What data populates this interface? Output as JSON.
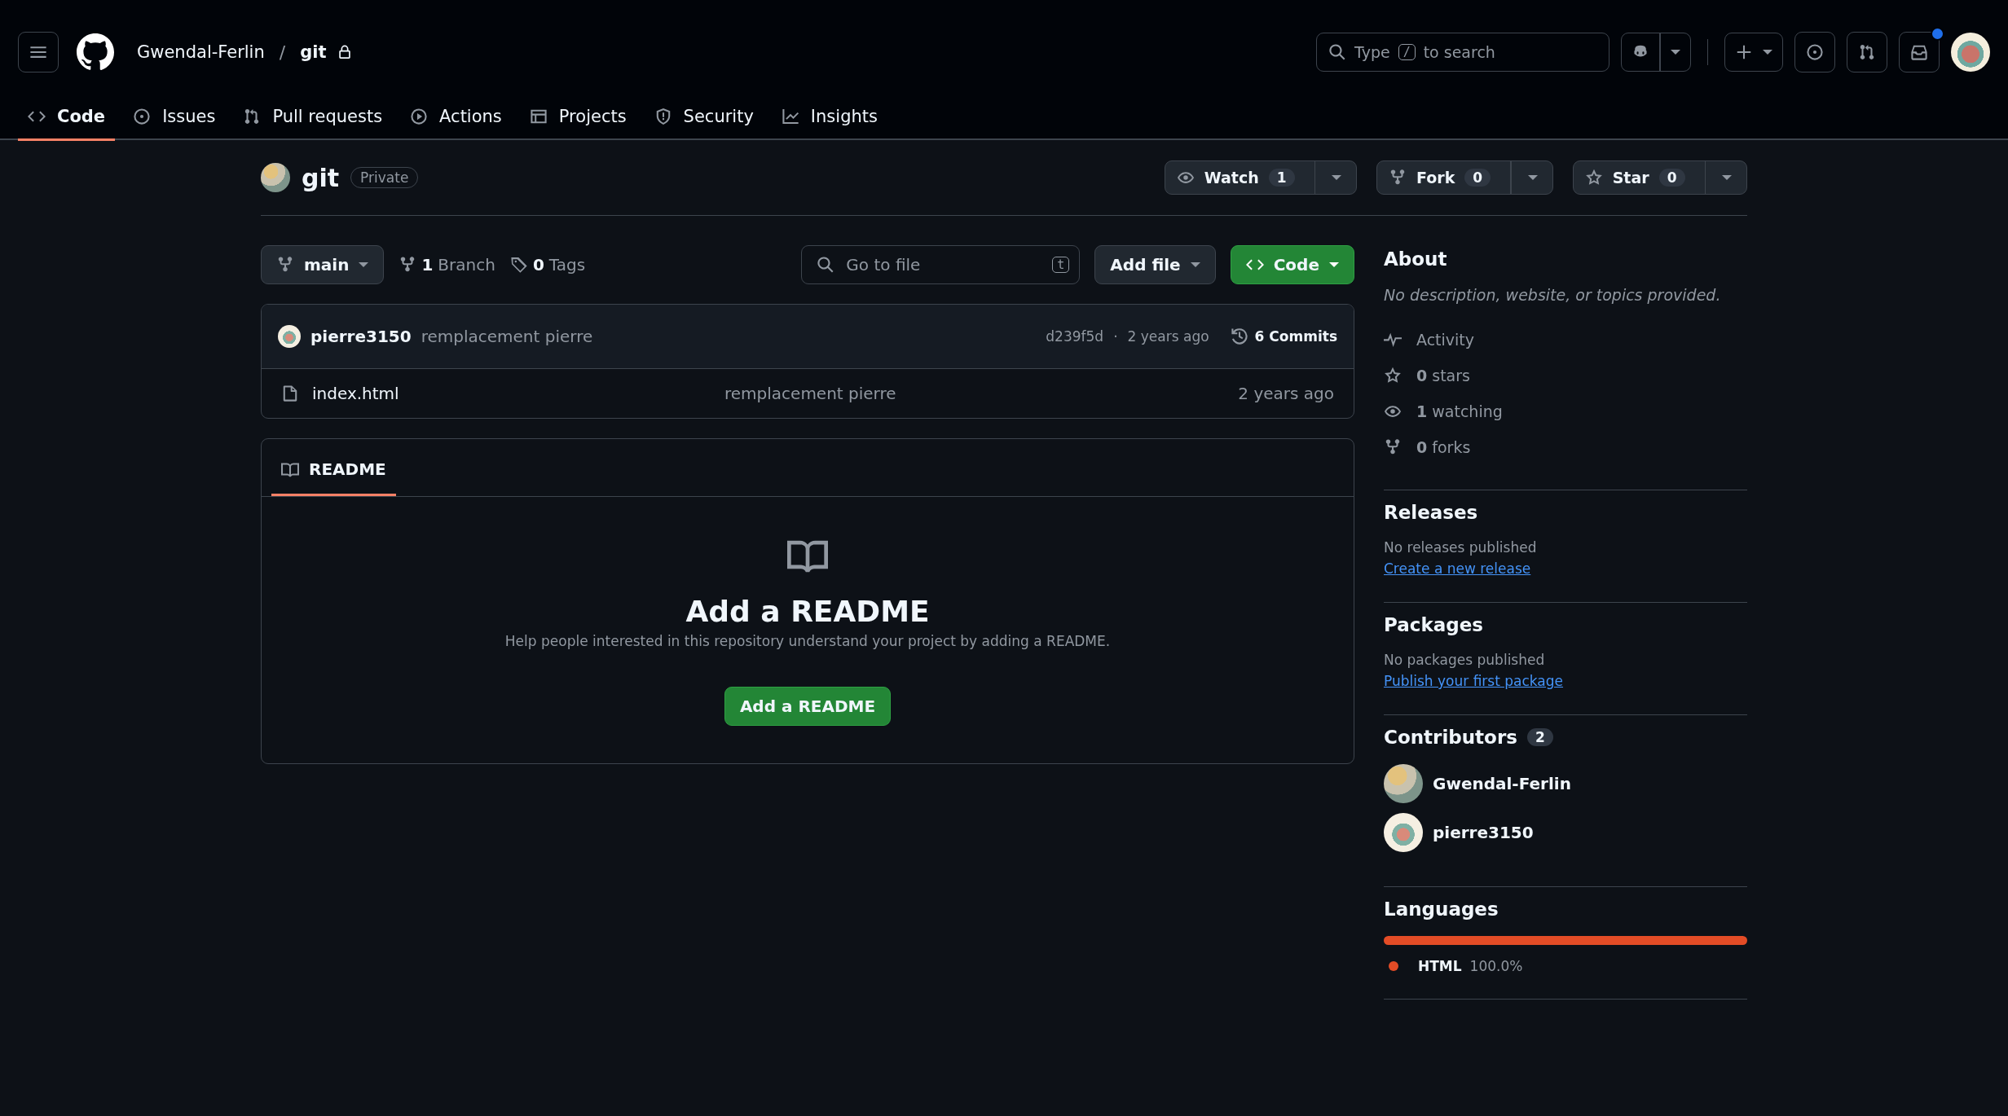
{
  "header": {
    "owner": "Gwendal-Ferlin",
    "separator": "/",
    "repo": "git",
    "search_prefix": "Type",
    "search_key": "/",
    "search_suffix": "to search",
    "notifications_unread": true
  },
  "tabs": [
    {
      "label": "Code",
      "selected": true
    },
    {
      "label": "Issues",
      "selected": false
    },
    {
      "label": "Pull requests",
      "selected": false
    },
    {
      "label": "Actions",
      "selected": false
    },
    {
      "label": "Projects",
      "selected": false
    },
    {
      "label": "Security",
      "selected": false
    },
    {
      "label": "Insights",
      "selected": false
    }
  ],
  "repo": {
    "name": "git",
    "visibility": "Private",
    "actions": [
      {
        "label": "Watch",
        "count": "1"
      },
      {
        "label": "Fork",
        "count": "0"
      },
      {
        "label": "Star",
        "count": "0"
      }
    ]
  },
  "toolbar": {
    "branch": "main",
    "branches_count": "1",
    "branches_label": "Branch",
    "tags_count": "0",
    "tags_label": "Tags",
    "go_to_file": "Go to file",
    "go_to_file_key": "t",
    "add_file": "Add file",
    "code": "Code"
  },
  "commit": {
    "author": "pierre3150",
    "message": "remplacement pierre",
    "hash": "d239f5d",
    "separator": "·",
    "age": "2 years ago",
    "commits": "6 Commits"
  },
  "files": [
    {
      "name": "index.html",
      "message": "remplacement pierre",
      "age": "2 years ago"
    }
  ],
  "readme": {
    "tab": "README",
    "title": "Add a README",
    "text": "Help people interested in this repository understand your project by adding a README.",
    "button": "Add a README"
  },
  "about": {
    "title": "About",
    "description": "No description, website, or topics provided.",
    "stats": [
      {
        "label": "Activity"
      },
      {
        "count": "0",
        "label": "stars"
      },
      {
        "count": "1",
        "label": "watching"
      },
      {
        "count": "0",
        "label": "forks"
      }
    ]
  },
  "releases": {
    "title": "Releases",
    "text": "No releases published",
    "link": "Create a new release"
  },
  "packages": {
    "title": "Packages",
    "text": "No packages published",
    "link": "Publish your first package"
  },
  "contributors": {
    "title": "Contributors",
    "count": "2",
    "people": [
      {
        "name": "Gwendal-Ferlin"
      },
      {
        "name": "pierre3150"
      }
    ]
  },
  "languages": {
    "title": "Languages",
    "items": [
      {
        "name": "HTML",
        "percent": "100.0%",
        "level": 1.0,
        "color": "#e34c26"
      }
    ]
  }
}
